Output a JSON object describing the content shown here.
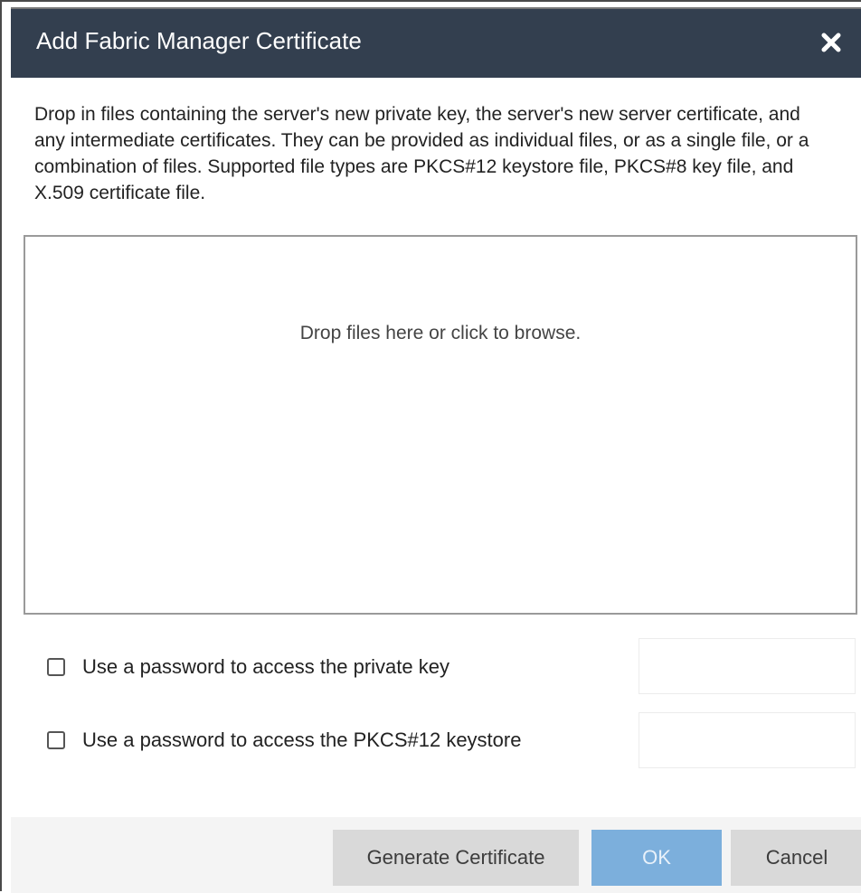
{
  "dialog": {
    "title": "Add Fabric Manager Certificate",
    "close_icon": "close-icon",
    "description": "Drop in files containing the server's new private key, the server's new server certificate, and any intermediate certificates. They can be provided as individual files, or as a single file, or a combination of files. Supported file types are PKCS#12 keystore file, PKCS#8 key file, and X.509 certificate file.",
    "dropzone_text": "Drop files here or click to browse."
  },
  "options": [
    {
      "label": "Use a password to access the private key",
      "checked": false,
      "value": ""
    },
    {
      "label": "Use a password to access the PKCS#12 keystore",
      "checked": false,
      "value": ""
    }
  ],
  "footer": {
    "generate_label": "Generate Certificate",
    "ok_label": "OK",
    "cancel_label": "Cancel"
  },
  "colors": {
    "title_bar": "#333f4f",
    "ok_button": "#7cafdc",
    "secondary_button": "#d9d9d9"
  }
}
